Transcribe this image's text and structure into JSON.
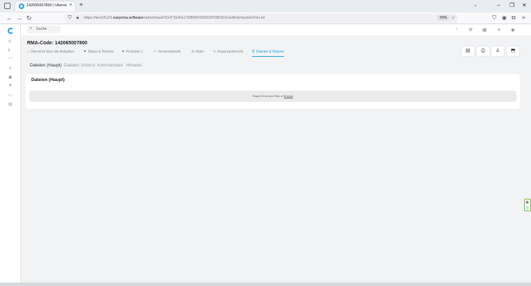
{
  "browser": {
    "tab_title": "142065007800 | Übersicht übe",
    "tab_close": "×",
    "new_tab": "+",
    "tabs_menu": "⌄",
    "window": {
      "minimize": "–",
      "maximize": "❐",
      "close": "✕"
    },
    "back": "←",
    "forward": "→",
    "reload": "↻",
    "url_prefix": "https://test16v23.",
    "url_host": "easyrma.software",
    "url_path": "/admin/task/01HT2EAG17MBWD9Z8XDP2B03H1/edit/de#publicFileList",
    "zoom": "70%"
  },
  "search": {
    "placeholder": "Suche"
  },
  "page": {
    "rma_code": "RMA-Code: 142065007800"
  },
  "nav_tabs": [
    {
      "label": "Übersicht über die Aufgaben",
      "icon": "⌂"
    },
    {
      "label": "Status & Historie",
      "icon": "⚑"
    },
    {
      "label": "Produkte 1",
      "icon": "⚑"
    },
    {
      "label": "Versanddetails",
      "icon": "⚐"
    },
    {
      "label": "Mails",
      "icon": "✉"
    },
    {
      "label": "Reparaturbericht",
      "icon": "✎"
    },
    {
      "label": "Dateien & Notizen",
      "icon": "⎘"
    }
  ],
  "sub_tabs": [
    {
      "label": "Dateien (Haupt)"
    },
    {
      "label": "Dateien (Intern)"
    },
    {
      "label": "Kommentare"
    },
    {
      "label": "Hinweis"
    }
  ],
  "card": {
    "title": "Dateien (Haupt)",
    "dropzone_text": "Drag & Drop your files or",
    "dropzone_link": "Browse"
  }
}
